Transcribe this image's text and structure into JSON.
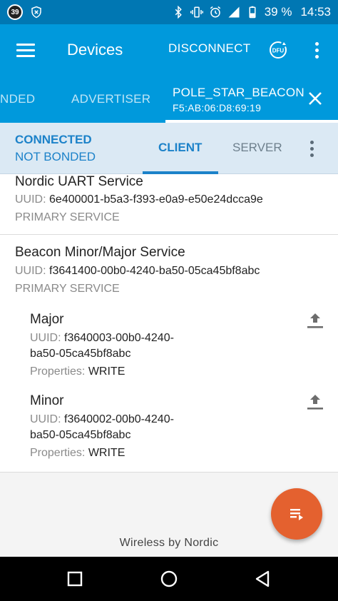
{
  "status_bar": {
    "badge": "39",
    "battery": "39 %",
    "time": "14:53"
  },
  "app_bar": {
    "title": "Devices",
    "disconnect_label": "DISCONNECT",
    "dfu_label": "DFU"
  },
  "tabs": {
    "bonded_label": "NDED",
    "advertiser_label": "ADVERTISER",
    "device_name": "POLE_STAR_BEACON",
    "device_address": "F5:AB:06:D8:69:19"
  },
  "connection": {
    "status": "CONNECTED",
    "bond": "NOT BONDED",
    "client_label": "CLIENT",
    "server_label": "SERVER"
  },
  "services": [
    {
      "name": "Nordic UART Service",
      "uuid_label": "UUID:",
      "uuid": "6e400001-b5a3-f393-e0a9-e50e24dcca9e",
      "type": "PRIMARY SERVICE"
    },
    {
      "name": "Beacon Minor/Major Service",
      "uuid_label": "UUID:",
      "uuid": "f3641400-00b0-4240-ba50-05ca45bf8abc",
      "type": "PRIMARY SERVICE",
      "characteristics": [
        {
          "name": "Major",
          "uuid_label": "UUID:",
          "uuid_line1": "f3640003-00b0-4240-",
          "uuid_line2": "ba50-05ca45bf8abc",
          "props_label": "Properties:",
          "props": "WRITE"
        },
        {
          "name": "Minor",
          "uuid_label": "UUID:",
          "uuid_line1": "f3640002-00b0-4240-",
          "uuid_line2": "ba50-05ca45bf8abc",
          "props_label": "Properties:",
          "props": "WRITE"
        }
      ]
    }
  ],
  "footer": "Wireless by Nordic",
  "colors": {
    "primary": "#0099dc",
    "primary_dark": "#0077b3",
    "accent": "#e4612f",
    "connection_bg": "#dbe9f4",
    "connection_text": "#1c82c9"
  }
}
